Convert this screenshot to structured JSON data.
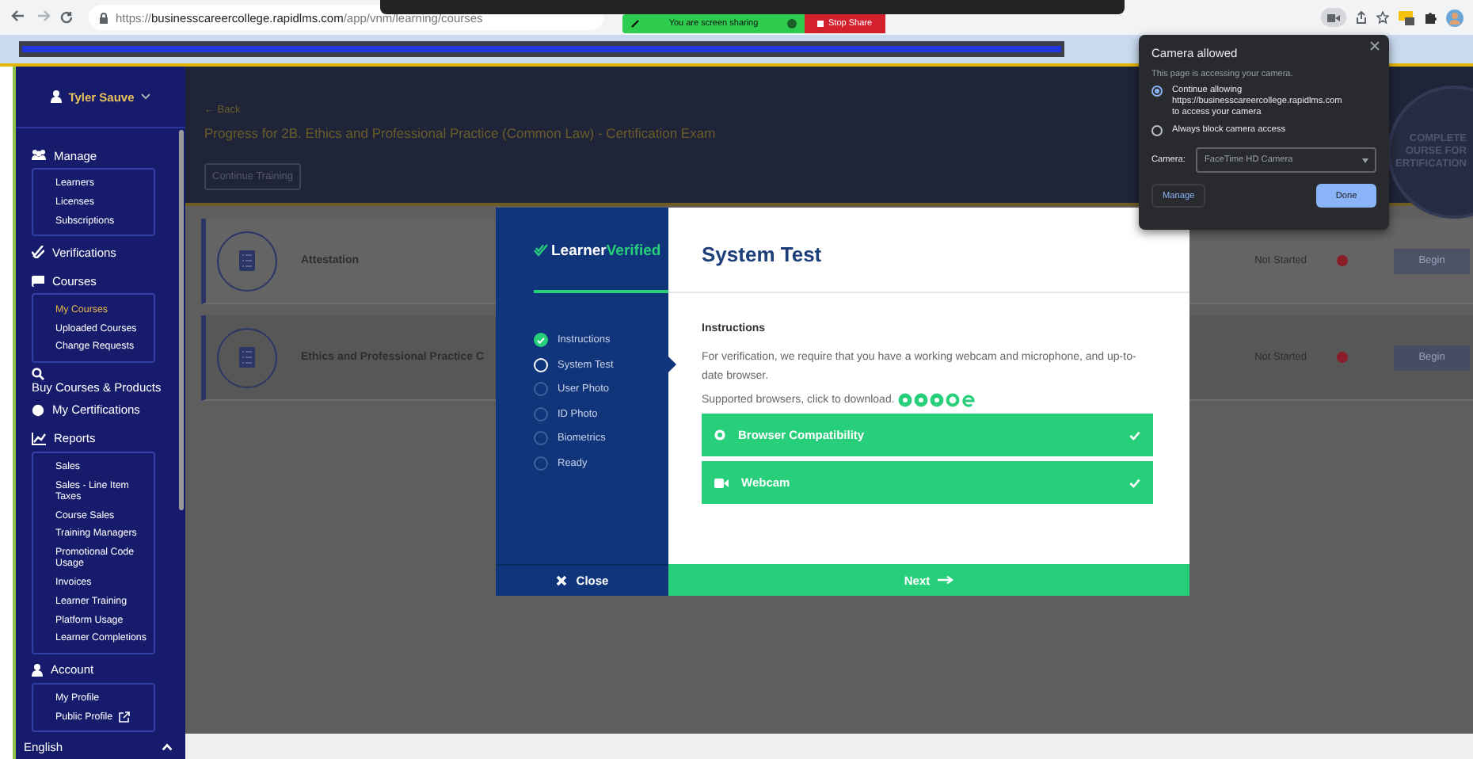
{
  "browser": {
    "url": {
      "scheme": "https://",
      "host": "businesscareercollege.rapidlms.com",
      "path": "/app/vnm/learning/courses"
    },
    "sharing": "You are screen sharing",
    "stop_share": "Stop Share"
  },
  "sidebar": {
    "user": "Tyler Sauve",
    "sections": [
      {
        "label": "Manage",
        "children": [
          {
            "label": "Learners",
            "selected": false
          },
          {
            "label": "Licenses",
            "selected": false
          },
          {
            "label": "Subscriptions",
            "selected": false
          }
        ]
      },
      {
        "label": "Verifications"
      },
      {
        "label": "Courses",
        "children": [
          {
            "label": "My Courses",
            "selected": true
          },
          {
            "label": "Uploaded Courses",
            "selected": false
          },
          {
            "label": "Change Requests",
            "selected": false
          }
        ]
      },
      {
        "label": "Buy Courses & Products"
      },
      {
        "label": "My Certifications"
      },
      {
        "label": "Reports",
        "children": [
          {
            "label": "Sales",
            "selected": false
          },
          {
            "label": "Sales - Line Item Taxes",
            "selected": false
          },
          {
            "label": "Course Sales",
            "selected": false
          },
          {
            "label": "Training Managers",
            "selected": false
          },
          {
            "label": "Promotional Code Usage",
            "selected": false
          },
          {
            "label": "Invoices",
            "selected": false
          },
          {
            "label": "Learner Training",
            "selected": false
          },
          {
            "label": "Platform Usage",
            "selected": false
          },
          {
            "label": "Learner Completions",
            "selected": false
          }
        ]
      },
      {
        "label": "Account",
        "children": [
          {
            "label": "My Profile",
            "selected": false
          },
          {
            "label": "Public Profile",
            "selected": false
          }
        ]
      }
    ],
    "language": "English"
  },
  "main": {
    "back": "← Back",
    "title": "Progress for 2B. Ethics and Professional Practice (Common Law) - Certification Exam",
    "continue_button": "Continue Training",
    "seal": [
      "COMPLETE",
      "OURSE FOR",
      "ERTIFICATION"
    ],
    "courses": [
      {
        "title": "Attestation",
        "status": "Not Started",
        "color": "#8b1c2a",
        "button": "Begin"
      },
      {
        "title": "Ethics and Professional Practice C",
        "status": "Not Started",
        "color": "#8b1c2a",
        "button": "Begin"
      }
    ]
  },
  "modal": {
    "brand": [
      "Learner",
      "Verified"
    ],
    "steps": [
      {
        "label": "Instructions",
        "completed": true,
        "selected": false
      },
      {
        "label": "System Test",
        "completed": false,
        "selected": true
      },
      {
        "label": "User Photo",
        "completed": false,
        "selected": false
      },
      {
        "label": "ID Photo",
        "completed": false,
        "selected": false
      },
      {
        "label": "Biometrics",
        "completed": false,
        "selected": false
      },
      {
        "label": "Ready",
        "completed": false,
        "selected": false
      }
    ],
    "heading": "System Test",
    "section_title": "Instructions",
    "text": "For verification, we require that you have a working webcam and microphone, and up-to-date browser.",
    "browsers_text": "Supported browsers, click to download.",
    "checks": [
      {
        "label": "Browser Compatibility",
        "kind": "browser",
        "checked": true
      },
      {
        "label": "Webcam",
        "kind": "webcam",
        "checked": true
      }
    ],
    "close": "Close",
    "next": "Next"
  },
  "camera_popup": {
    "title": "Camera allowed",
    "subtitle": "This page is accessing your camera.",
    "options": [
      {
        "label": "Continue allowing https://businesscareercollege.rapidlms.com to access your camera",
        "selected": true
      },
      {
        "label": "Always block camera access",
        "selected": false
      }
    ],
    "camera_label": "Camera:",
    "camera_value": "FaceTime HD Camera",
    "manage": "Manage",
    "done": "Done"
  }
}
